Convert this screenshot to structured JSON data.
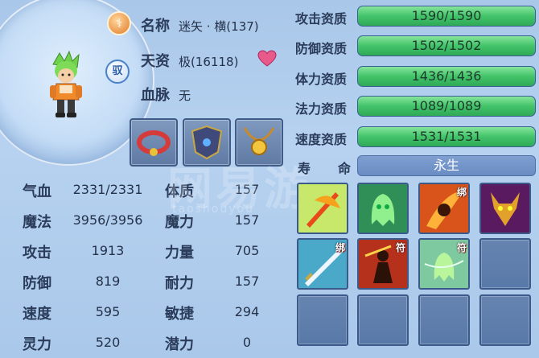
{
  "profile": {
    "name_label": "名称",
    "name_value": "迷矢 · 横(137)",
    "grade_label": "天资",
    "grade_value": "极(16118)",
    "bloodline_label": "血脉",
    "bloodline_value": "无",
    "gender_badge": "驭",
    "tier_badge": "⚕"
  },
  "stats": [
    {
      "label": "气血",
      "value": "2331/2331"
    },
    {
      "label": "魔法",
      "value": "3956/3956"
    },
    {
      "label": "攻击",
      "value": "1913"
    },
    {
      "label": "防御",
      "value": "819"
    },
    {
      "label": "速度",
      "value": "595"
    },
    {
      "label": "灵力",
      "value": "520"
    }
  ],
  "attributes": [
    {
      "label": "体质",
      "value": "157"
    },
    {
      "label": "魔力",
      "value": "157"
    },
    {
      "label": "力量",
      "value": "705"
    },
    {
      "label": "耐力",
      "value": "157"
    },
    {
      "label": "敏捷",
      "value": "294"
    },
    {
      "label": "潜力",
      "value": "0"
    }
  ],
  "aptitudes": [
    {
      "label": "攻击资质",
      "text": "1590/1590",
      "fill": 1.0
    },
    {
      "label": "防御资质",
      "text": "1502/1502",
      "fill": 1.0
    },
    {
      "label": "体力资质",
      "text": "1436/1436",
      "fill": 1.0
    },
    {
      "label": "法力资质",
      "text": "1089/1089",
      "fill": 1.0
    },
    {
      "label": "速度资质",
      "text": "1531/1531",
      "fill": 1.0
    }
  ],
  "lifespan": {
    "label_a": "寿",
    "label_b": "命",
    "value": "永生"
  },
  "skill_tags": {
    "bind": "绑",
    "talisman": "符"
  },
  "watermark": {
    "main": "网易游",
    "sub": "taoshouyou"
  },
  "colors": {
    "accent_green": "#43c36a",
    "bar_blue": "#5c86c2",
    "panel_bg": "#aac8ea"
  }
}
